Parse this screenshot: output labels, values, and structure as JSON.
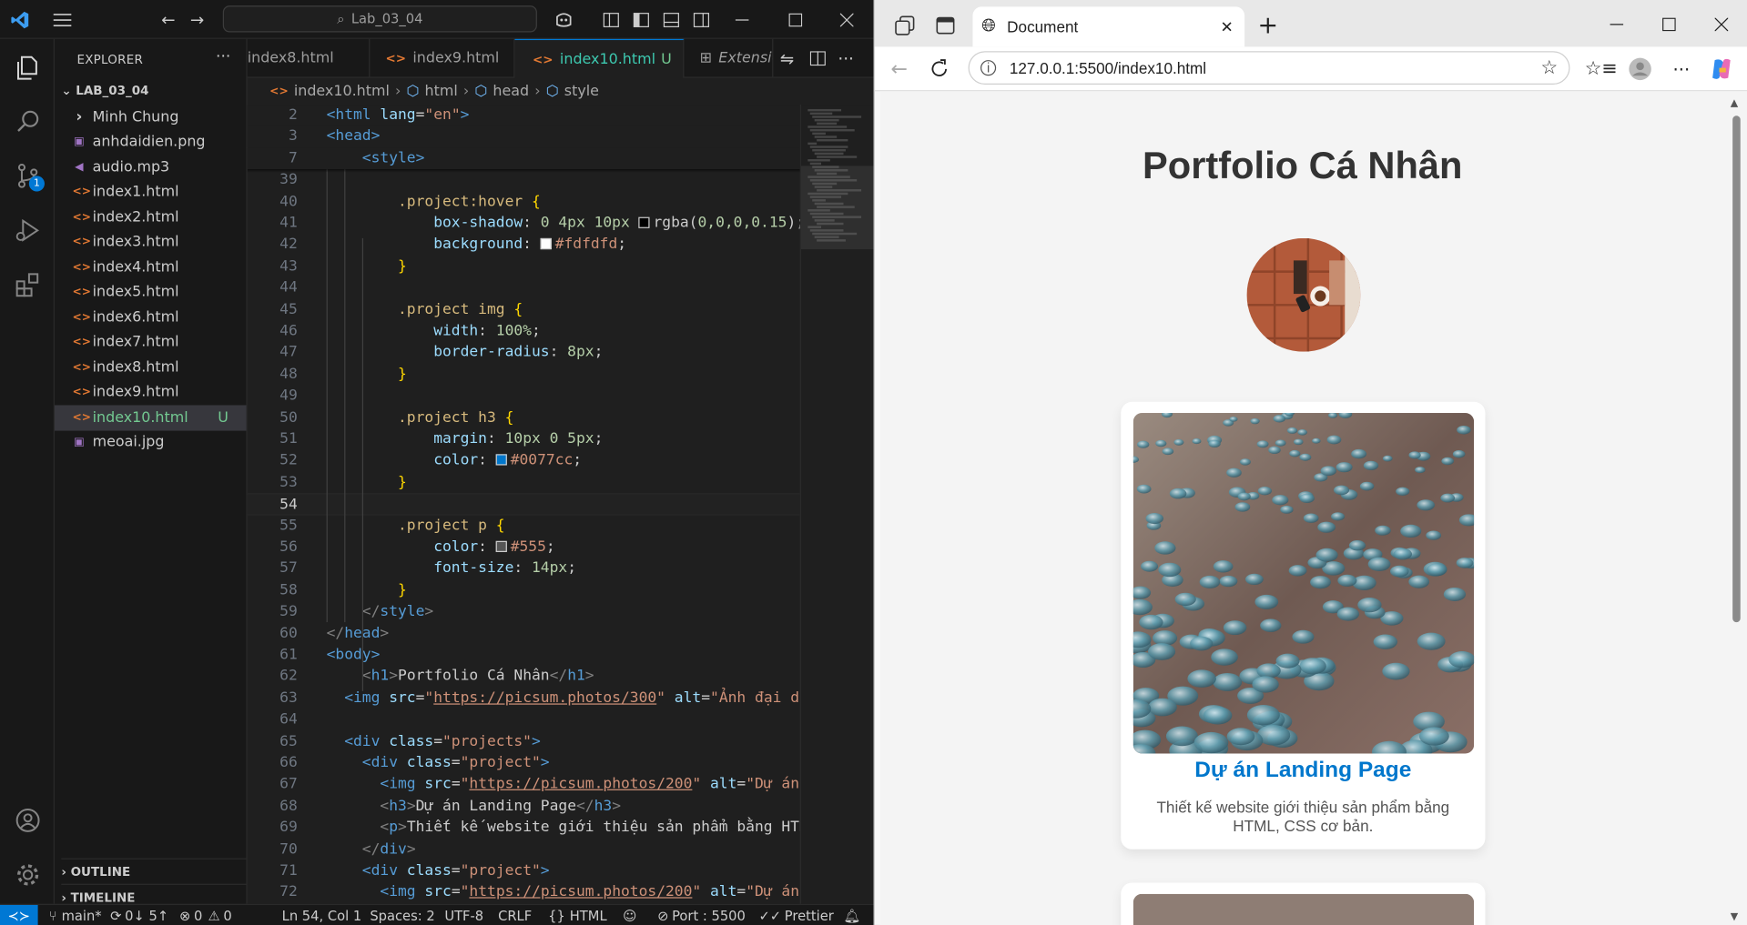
{
  "vscode": {
    "search_text": "Lab_03_04",
    "explorer": {
      "title": "EXPLORER",
      "folder": "LAB_03_04",
      "items": [
        {
          "label": "Minh Chung",
          "kind": "folder"
        },
        {
          "label": "anhdaidien.png",
          "kind": "image"
        },
        {
          "label": "audio.mp3",
          "kind": "audio"
        },
        {
          "label": "index1.html",
          "kind": "html"
        },
        {
          "label": "index2.html",
          "kind": "html"
        },
        {
          "label": "index3.html",
          "kind": "html"
        },
        {
          "label": "index4.html",
          "kind": "html"
        },
        {
          "label": "index5.html",
          "kind": "html"
        },
        {
          "label": "index6.html",
          "kind": "html"
        },
        {
          "label": "index7.html",
          "kind": "html"
        },
        {
          "label": "index8.html",
          "kind": "html"
        },
        {
          "label": "index9.html",
          "kind": "html"
        },
        {
          "label": "index10.html",
          "kind": "html",
          "status": "U",
          "selected": true
        },
        {
          "label": "meoai.jpg",
          "kind": "image"
        }
      ],
      "outline_label": "OUTLINE",
      "timeline_label": "TIMELINE"
    },
    "tabs": [
      {
        "label": "index8.html",
        "active": false
      },
      {
        "label": "index9.html",
        "active": false
      },
      {
        "label": "index10.html",
        "status": "U",
        "active": true
      },
      {
        "label": "Extensio",
        "active": false
      }
    ],
    "breadcrumb": [
      "index10.html",
      "html",
      "head",
      "style"
    ],
    "status": {
      "branch": "main*",
      "sync": "0↓ 5↑",
      "errors": "0",
      "warnings": "0",
      "position": "Ln 54, Col 1",
      "spaces": "Spaces: 2",
      "encoding": "UTF-8",
      "eol": "CRLF",
      "language": "HTML",
      "port": "Port : 5500",
      "formatter": "Prettier"
    },
    "colors": {
      "accent": "#0078d4",
      "bg": "#1f1f1f",
      "sidebar_bg": "#181818"
    }
  },
  "code_lines": [
    {
      "n": "2",
      "t": [
        [
          "t-tag",
          "<html "
        ],
        [
          "t-attr",
          "lang"
        ],
        [
          "t-txt",
          "="
        ],
        [
          "t-str",
          "\"en\""
        ],
        [
          "t-tag",
          ">"
        ]
      ]
    },
    {
      "n": "3",
      "t": [
        [
          "t-tag",
          "<head>"
        ]
      ]
    },
    {
      "n": "7",
      "t": [
        [
          "t-txt",
          "    "
        ],
        [
          "t-tag",
          "<style>"
        ]
      ]
    },
    {
      "n": "39",
      "t": []
    },
    {
      "n": "40",
      "t": [
        [
          "t-txt",
          "        "
        ],
        [
          "t-sel",
          ".project:hover "
        ],
        [
          "t-brk",
          "{"
        ]
      ]
    },
    {
      "n": "41",
      "t": [
        [
          "t-txt",
          "            "
        ],
        [
          "t-prop",
          "box-shadow"
        ],
        [
          "t-txt",
          ": "
        ],
        [
          "t-num",
          "0 4px 10px "
        ],
        [
          "sw",
          "#000000"
        ],
        [
          "t-txt",
          "rgba("
        ],
        [
          "t-num",
          "0,0,0,0.15"
        ],
        [
          "t-txt",
          ");"
        ]
      ]
    },
    {
      "n": "42",
      "t": [
        [
          "t-txt",
          "            "
        ],
        [
          "t-prop",
          "background"
        ],
        [
          "t-txt",
          ": "
        ],
        [
          "sw",
          "#fdfdfd"
        ],
        [
          "t-str",
          "#fdfdfd"
        ],
        [
          "t-txt",
          ";"
        ]
      ]
    },
    {
      "n": "43",
      "t": [
        [
          "t-txt",
          "        "
        ],
        [
          "t-brk",
          "}"
        ]
      ]
    },
    {
      "n": "44",
      "t": []
    },
    {
      "n": "45",
      "t": [
        [
          "t-txt",
          "        "
        ],
        [
          "t-sel",
          ".project img "
        ],
        [
          "t-brk",
          "{"
        ]
      ]
    },
    {
      "n": "46",
      "t": [
        [
          "t-txt",
          "            "
        ],
        [
          "t-prop",
          "width"
        ],
        [
          "t-txt",
          ": "
        ],
        [
          "t-num",
          "100%"
        ],
        [
          "t-txt",
          ";"
        ]
      ]
    },
    {
      "n": "47",
      "t": [
        [
          "t-txt",
          "            "
        ],
        [
          "t-prop",
          "border-radius"
        ],
        [
          "t-txt",
          ": "
        ],
        [
          "t-num",
          "8px"
        ],
        [
          "t-txt",
          ";"
        ]
      ]
    },
    {
      "n": "48",
      "t": [
        [
          "t-txt",
          "        "
        ],
        [
          "t-brk",
          "}"
        ]
      ]
    },
    {
      "n": "49",
      "t": []
    },
    {
      "n": "50",
      "t": [
        [
          "t-txt",
          "        "
        ],
        [
          "t-sel",
          ".project h3 "
        ],
        [
          "t-brk",
          "{"
        ]
      ]
    },
    {
      "n": "51",
      "t": [
        [
          "t-txt",
          "            "
        ],
        [
          "t-prop",
          "margin"
        ],
        [
          "t-txt",
          ": "
        ],
        [
          "t-num",
          "10px 0 5px"
        ],
        [
          "t-txt",
          ";"
        ]
      ]
    },
    {
      "n": "52",
      "t": [
        [
          "t-txt",
          "            "
        ],
        [
          "t-prop",
          "color"
        ],
        [
          "t-txt",
          ": "
        ],
        [
          "sw",
          "#0077cc"
        ],
        [
          "t-str",
          "#0077cc"
        ],
        [
          "t-txt",
          ";"
        ]
      ]
    },
    {
      "n": "53",
      "t": [
        [
          "t-txt",
          "        "
        ],
        [
          "t-brk",
          "}"
        ]
      ]
    },
    {
      "n": "54",
      "t": [],
      "cur": true
    },
    {
      "n": "55",
      "t": [
        [
          "t-txt",
          "        "
        ],
        [
          "t-sel",
          ".project p "
        ],
        [
          "t-brk",
          "{"
        ]
      ]
    },
    {
      "n": "56",
      "t": [
        [
          "t-txt",
          "            "
        ],
        [
          "t-prop",
          "color"
        ],
        [
          "t-txt",
          ": "
        ],
        [
          "sw",
          "#555555"
        ],
        [
          "t-str",
          "#555"
        ],
        [
          "t-txt",
          ";"
        ]
      ]
    },
    {
      "n": "57",
      "t": [
        [
          "t-txt",
          "            "
        ],
        [
          "t-prop",
          "font-size"
        ],
        [
          "t-txt",
          ": "
        ],
        [
          "t-num",
          "14px"
        ],
        [
          "t-txt",
          ";"
        ]
      ]
    },
    {
      "n": "58",
      "t": [
        [
          "t-txt",
          "        "
        ],
        [
          "t-brk",
          "}"
        ]
      ]
    },
    {
      "n": "59",
      "t": [
        [
          "t-txt",
          "    "
        ],
        [
          "t-gray",
          "</"
        ],
        [
          "t-tag",
          "style"
        ],
        [
          "t-gray",
          ">"
        ]
      ]
    },
    {
      "n": "60",
      "t": [
        [
          "t-gray",
          "</"
        ],
        [
          "t-tag",
          "head"
        ],
        [
          "t-gray",
          ">"
        ]
      ]
    },
    {
      "n": "61",
      "t": [
        [
          "t-tag",
          "<body>"
        ]
      ]
    },
    {
      "n": "62",
      "t": [
        [
          "t-txt",
          "    "
        ],
        [
          "t-gray",
          "<"
        ],
        [
          "t-tag",
          "h1"
        ],
        [
          "t-gray",
          ">"
        ],
        [
          "t-txt",
          "Portfolio Cá Nhân"
        ],
        [
          "t-gray",
          "</"
        ],
        [
          "t-tag",
          "h1"
        ],
        [
          "t-gray",
          ">"
        ]
      ]
    },
    {
      "n": "63",
      "t": [
        [
          "t-txt",
          "  "
        ],
        [
          "t-tag",
          "<img "
        ],
        [
          "t-attr",
          "src"
        ],
        [
          "t-txt",
          "="
        ],
        [
          "t-str",
          "\""
        ],
        [
          "t-url",
          "https://picsum.photos/300"
        ],
        [
          "t-str",
          "\""
        ],
        [
          "t-txt",
          " "
        ],
        [
          "t-attr",
          "alt"
        ],
        [
          "t-txt",
          "="
        ],
        [
          "t-str",
          "\"Ảnh đại di"
        ]
      ]
    },
    {
      "n": "64",
      "t": []
    },
    {
      "n": "65",
      "t": [
        [
          "t-txt",
          "  "
        ],
        [
          "t-tag",
          "<div "
        ],
        [
          "t-attr",
          "class"
        ],
        [
          "t-txt",
          "="
        ],
        [
          "t-str",
          "\"projects\""
        ],
        [
          "t-tag",
          ">"
        ]
      ]
    },
    {
      "n": "66",
      "t": [
        [
          "t-txt",
          "    "
        ],
        [
          "t-tag",
          "<div "
        ],
        [
          "t-attr",
          "class"
        ],
        [
          "t-txt",
          "="
        ],
        [
          "t-str",
          "\"project\""
        ],
        [
          "t-tag",
          ">"
        ]
      ]
    },
    {
      "n": "67",
      "t": [
        [
          "t-txt",
          "      "
        ],
        [
          "t-tag",
          "<img "
        ],
        [
          "t-attr",
          "src"
        ],
        [
          "t-txt",
          "="
        ],
        [
          "t-str",
          "\""
        ],
        [
          "t-url",
          "https://picsum.photos/200"
        ],
        [
          "t-str",
          "\""
        ],
        [
          "t-txt",
          " "
        ],
        [
          "t-attr",
          "alt"
        ],
        [
          "t-txt",
          "="
        ],
        [
          "t-str",
          "\"Dự án"
        ]
      ]
    },
    {
      "n": "68",
      "t": [
        [
          "t-txt",
          "      "
        ],
        [
          "t-gray",
          "<"
        ],
        [
          "t-tag",
          "h3"
        ],
        [
          "t-gray",
          ">"
        ],
        [
          "t-txt",
          "Dự án Landing Page"
        ],
        [
          "t-gray",
          "</"
        ],
        [
          "t-tag",
          "h3"
        ],
        [
          "t-gray",
          ">"
        ]
      ]
    },
    {
      "n": "69",
      "t": [
        [
          "t-txt",
          "      "
        ],
        [
          "t-gray",
          "<"
        ],
        [
          "t-tag",
          "p"
        ],
        [
          "t-gray",
          ">"
        ],
        [
          "t-txt",
          "Thiết kế website giới thiệu sản phẩm bằng HTM"
        ]
      ]
    },
    {
      "n": "70",
      "t": [
        [
          "t-txt",
          "    "
        ],
        [
          "t-gray",
          "</"
        ],
        [
          "t-tag",
          "div"
        ],
        [
          "t-gray",
          ">"
        ]
      ]
    },
    {
      "n": "71",
      "t": [
        [
          "t-txt",
          "    "
        ],
        [
          "t-tag",
          "<div "
        ],
        [
          "t-attr",
          "class"
        ],
        [
          "t-txt",
          "="
        ],
        [
          "t-str",
          "\"project\""
        ],
        [
          "t-tag",
          ">"
        ]
      ]
    },
    {
      "n": "72",
      "t": [
        [
          "t-txt",
          "      "
        ],
        [
          "t-tag",
          "<img "
        ],
        [
          "t-attr",
          "src"
        ],
        [
          "t-txt",
          "="
        ],
        [
          "t-str",
          "\""
        ],
        [
          "t-url",
          "https://picsum.photos/200"
        ],
        [
          "t-str",
          "\""
        ],
        [
          "t-txt",
          " "
        ],
        [
          "t-attr",
          "alt"
        ],
        [
          "t-txt",
          "="
        ],
        [
          "t-str",
          "\"Dự án"
        ]
      ]
    }
  ],
  "browser": {
    "tab_title": "Document",
    "url": "127.0.0.1:5500/index10.html",
    "page": {
      "title": "Portfolio Cá Nhân",
      "project_title": "Dự án Landing Page",
      "project_desc": "Thiết kế website giới thiệu sản phẩm bằng HTML, CSS cơ bản."
    },
    "colors": {
      "link": "#0077cc",
      "text": "#555555",
      "heading": "#333333"
    }
  }
}
